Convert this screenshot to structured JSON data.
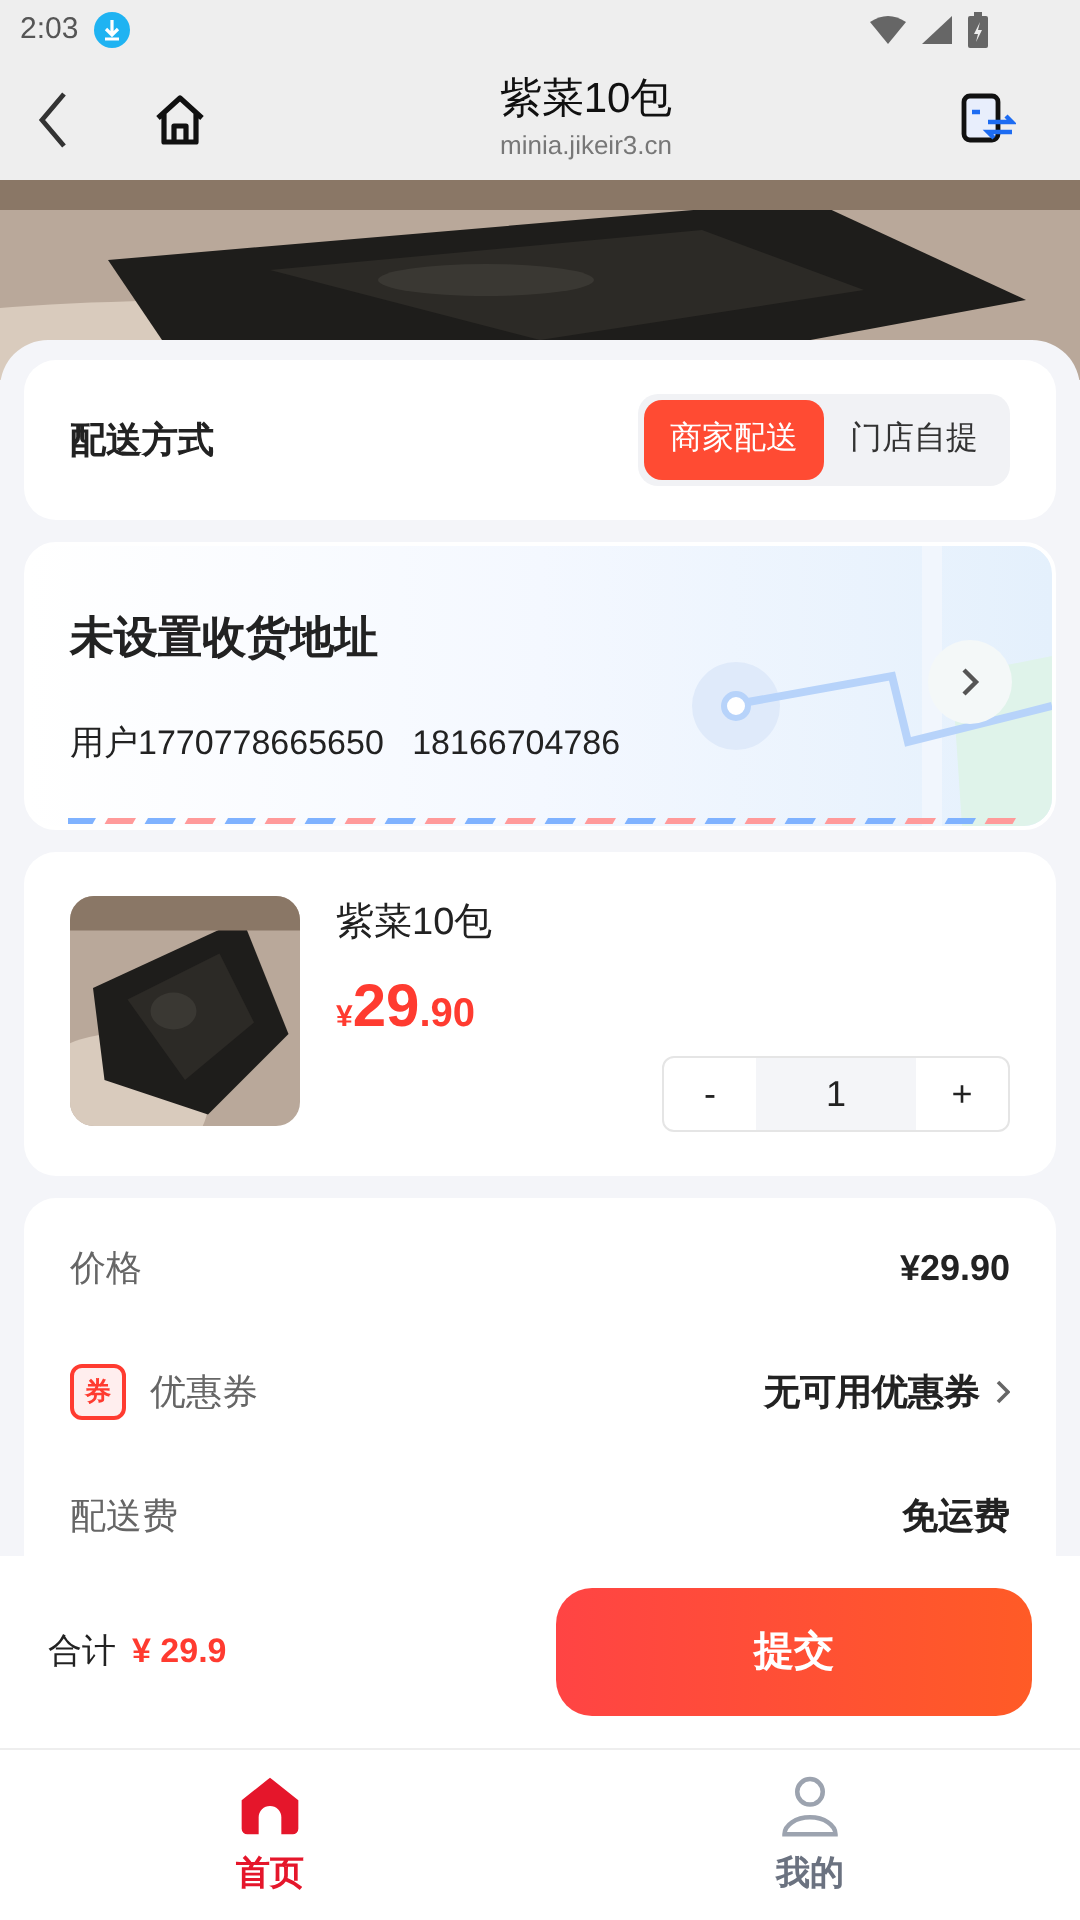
{
  "status_bar": {
    "time": "2:03"
  },
  "nav": {
    "title": "紫菜10包",
    "subtitle": "minia.jikeir3.cn"
  },
  "delivery": {
    "label": "配送方式",
    "options": [
      {
        "label": "商家配送",
        "selected": true
      },
      {
        "label": "门店自提",
        "selected": false
      }
    ]
  },
  "address": {
    "title": "未设置收货地址",
    "contact": "用户1770778665650   18166704786"
  },
  "product": {
    "name": "紫菜10包",
    "currency": "¥",
    "price_int": "29",
    "price_dec": ".90",
    "quantity": "1",
    "minus": "-",
    "plus": "+"
  },
  "fees": [
    {
      "kind": "plain",
      "label": "价格",
      "value": "¥29.90"
    },
    {
      "kind": "coupon",
      "badge": "券",
      "label": "优惠券",
      "value": "无可用优惠券"
    },
    {
      "kind": "plain",
      "label": "配送费",
      "value": "免运费"
    }
  ],
  "footer": {
    "total_label": "合计",
    "total": "¥ 29.9",
    "submit": "提交"
  },
  "tabs": [
    {
      "label": "首页",
      "selected": true
    },
    {
      "label": "我的",
      "selected": false
    }
  ]
}
